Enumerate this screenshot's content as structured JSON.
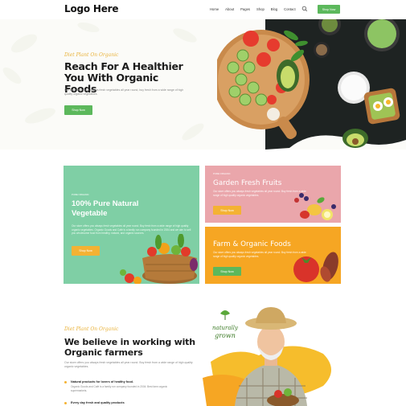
{
  "header": {
    "logo": "Logo Here",
    "nav": [
      "Home",
      "About",
      "Pages",
      "Shop",
      "Blog",
      "Contact"
    ],
    "search_icon": "search-icon",
    "shop_button": "Shop Now"
  },
  "hero": {
    "tag": "Diet Plant On Organic",
    "title": "Reach For A Healthier You With Organic Foods",
    "description": "Our store offers you always fresh vegetables all year round, buy fresh from a wide range of high quality organic vegetables.",
    "button": "Shop Now"
  },
  "cards": {
    "main": {
      "tag": "PURE ORGANIC",
      "title": "100% Pure Natural Vegetable",
      "description": "Our store offers you always fresh vegetables all year round. Buy fresh from a wide range of high quality organic vegetables. Organic Goods and Café is a family run company founded in 2004 and we aim to sell you wholesome food from healthy, natural, and organic sources.",
      "button": "Shop Now"
    },
    "fruits": {
      "tag": "PURE ORGANIC",
      "title": "Garden Fresh Fruits",
      "description": "Our store offers you always fresh vegetables all year round. Buy fresh from a wide range of high quality organic vegetables.",
      "button": "Shop Now"
    },
    "farm": {
      "tag": "PURE ORGANIC",
      "title": "Farm & Organic Foods",
      "description": "Our store offers you always fresh vegetables all year round. Buy fresh from a wide range of high quality organic vegetables.",
      "button": "Shop Now"
    }
  },
  "about": {
    "tag": "Diet Plant On Organic",
    "title": "We believe in working with Organic farmers",
    "description": "Our store offers you always fresh vegetables all year round. Buy fresh from a wide range of high quality organic vegetables.",
    "features": [
      {
        "title": "Natural products for lovers of healthy food.",
        "desc": "Organic Goods and Café is a family run company founded in 2004. Best farm organic supermarkets."
      },
      {
        "title": "Every day fresh and quality products",
        "desc": ""
      }
    ],
    "badge": "naturally grown"
  },
  "colors": {
    "green": "#5cb85c",
    "mint": "#7fcfa5",
    "pink": "#eaa6ab",
    "orange": "#f6a623",
    "yellow": "#f4b233"
  }
}
